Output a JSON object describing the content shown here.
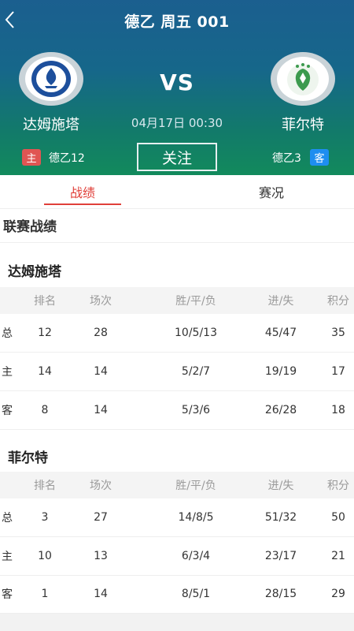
{
  "header": {
    "title": "德乙 周五 001",
    "vs": "VS",
    "match_time": "04月17日 00:30",
    "follow_label": "关注",
    "home": {
      "name": "达姆施塔",
      "badge": "主",
      "rank_text": "德乙12",
      "logo_icon": "darmstadt-crest"
    },
    "away": {
      "name": "菲尔特",
      "badge": "客",
      "rank_text": "德乙3",
      "logo_icon": "greuther-furth-crest"
    }
  },
  "tabs": [
    {
      "label": "战绩",
      "active": true
    },
    {
      "label": "赛况",
      "active": false
    }
  ],
  "section": {
    "title": "联赛战绩"
  },
  "columns": [
    "排名",
    "场次",
    "胜/平/负",
    "进/失",
    "积分"
  ],
  "tables": [
    {
      "team": "达姆施塔",
      "rows": [
        {
          "type": "总",
          "rank": "12",
          "played": "28",
          "wdl": "10/5/13",
          "goals": "45/47",
          "points": "35"
        },
        {
          "type": "主",
          "rank": "14",
          "played": "14",
          "wdl": "5/2/7",
          "goals": "19/19",
          "points": "17"
        },
        {
          "type": "客",
          "rank": "8",
          "played": "14",
          "wdl": "5/3/6",
          "goals": "26/28",
          "points": "18"
        }
      ]
    },
    {
      "team": "菲尔特",
      "rows": [
        {
          "type": "总",
          "rank": "3",
          "played": "27",
          "wdl": "14/8/5",
          "goals": "51/32",
          "points": "50"
        },
        {
          "type": "主",
          "rank": "10",
          "played": "13",
          "wdl": "6/3/4",
          "goals": "23/17",
          "points": "21"
        },
        {
          "type": "客",
          "rank": "1",
          "played": "14",
          "wdl": "8/5/1",
          "goals": "28/15",
          "points": "29"
        }
      ]
    }
  ],
  "colors": {
    "accent": "#e0403a",
    "home_badge": "#e05553",
    "away_badge": "#1e8ef0"
  }
}
